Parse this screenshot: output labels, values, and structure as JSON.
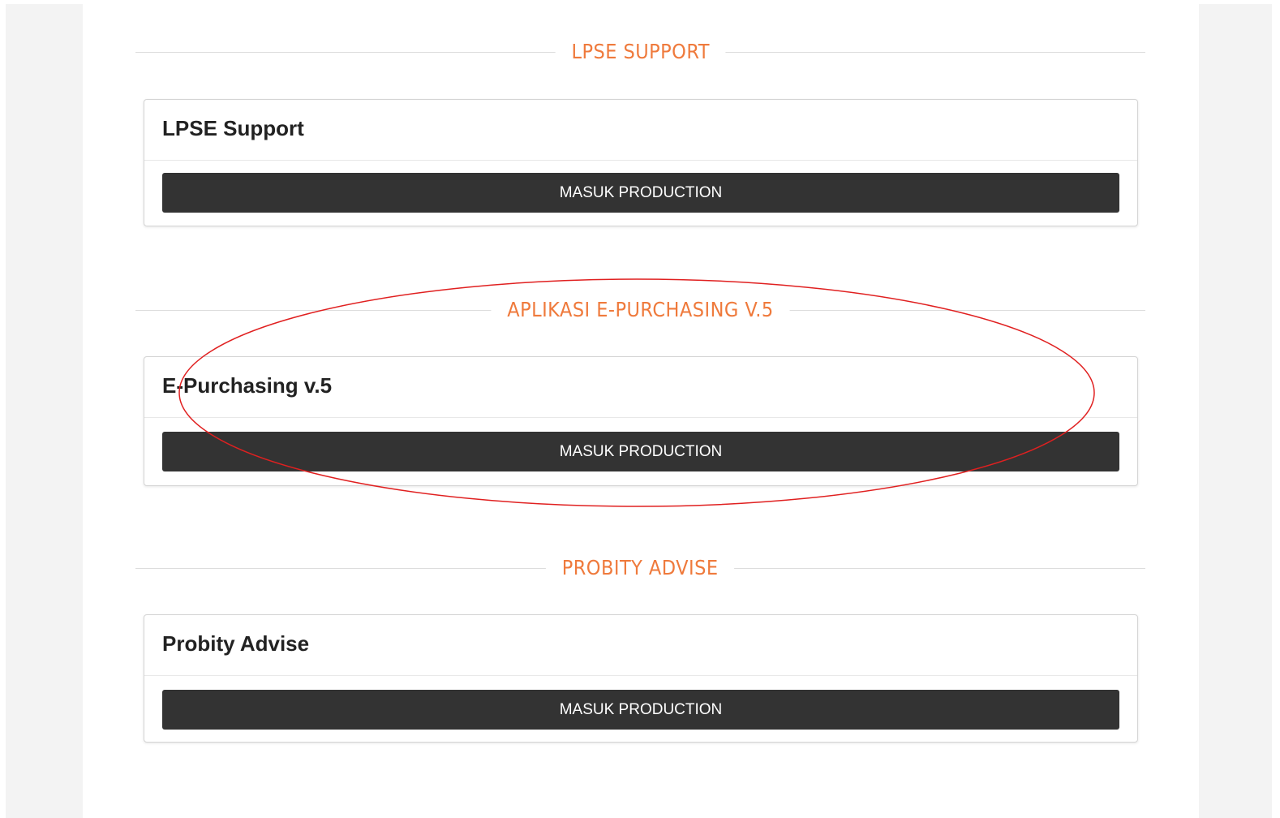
{
  "sections": [
    {
      "heading": "LPSE SUPPORT",
      "card_title": "LPSE Support",
      "button_label": "MASUK PRODUCTION"
    },
    {
      "heading": "APLIKASI E-PURCHASING V.5",
      "card_title": "E-Purchasing v.5",
      "button_label": "MASUK PRODUCTION"
    },
    {
      "heading": "PROBITY ADVISE",
      "card_title": "Probity Advise",
      "button_label": "MASUK PRODUCTION"
    }
  ],
  "colors": {
    "heading": "#ef7a3c",
    "button": "#333333",
    "annotation": "#e02020"
  }
}
